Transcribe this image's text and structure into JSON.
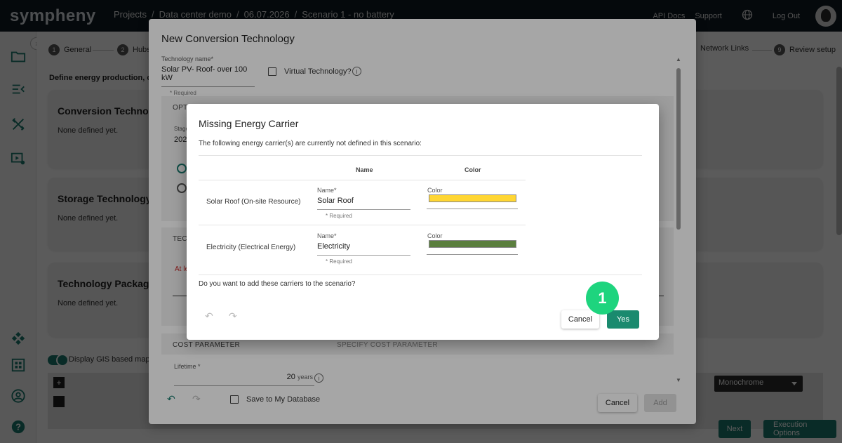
{
  "app": {
    "logo": "sympheny"
  },
  "breadcrumb": [
    "Projects",
    "Data center demo",
    "06.07.2026",
    "Scenario 1 - no battery"
  ],
  "topnav": {
    "api_docs": "API Docs",
    "support": "Support",
    "logout": "Log Out"
  },
  "stepper": [
    {
      "num": "1",
      "label": "General"
    },
    {
      "num": "2",
      "label": "Hubs"
    },
    {
      "num": "",
      "label": "Network Links"
    },
    {
      "num": "9",
      "label": "Review setup"
    }
  ],
  "page": {
    "subtitle": "Define energy production, conv",
    "cards": [
      {
        "title": "Conversion Technolo",
        "text": "None defined yet."
      },
      {
        "title": "Storage Technology",
        "text": "None defined yet."
      },
      {
        "title": "Technology Package",
        "text": "None defined yet."
      }
    ],
    "gis_label": "Display GIS based map",
    "map_style": "Monochrome",
    "next_label": "Next",
    "exec_label": "Execution Options"
  },
  "conversion_modal": {
    "title": "New Conversion Technology",
    "tech_name_label": "Technology name*",
    "tech_name_value": "Solar PV- Roof- over 100 kW",
    "required": "* Required",
    "virtual_label": "Virtual Technology?",
    "section_opt": "OPT",
    "stage_label": "Stage",
    "stage_value": "202",
    "section_tec": "TEC",
    "warning": "At le",
    "cost_header": "COST PARAMETER",
    "cost_header_right": "SPECIFY COST PARAMETER",
    "lifetime_label": "Lifetime *",
    "lifetime_value": "20",
    "lifetime_unit": "years",
    "save_db_label": "Save to My Database",
    "cancel_label": "Cancel",
    "add_label": "Add"
  },
  "carrier_modal": {
    "title": "Missing Energy Carrier",
    "description": "The following energy carrier(s) are currently not defined in this scenario:",
    "col_name": "Name",
    "col_color": "Color",
    "rows": [
      {
        "label": "Solar Roof (On-site Resource)",
        "name_label": "Name*",
        "name_value": "Solar Roof",
        "required": "* Required",
        "color_label": "Color",
        "color": "#ffd633"
      },
      {
        "label": "Electricity (Electrical Energy)",
        "name_label": "Name*",
        "name_value": "Electricity",
        "required": "* Required",
        "color_label": "Color",
        "color": "#5b7f3e"
      }
    ],
    "question": "Do you want to add these carriers to the scenario?",
    "cancel_label": "Cancel",
    "yes_label": "Yes"
  },
  "annotation": {
    "step_badge": "1"
  }
}
